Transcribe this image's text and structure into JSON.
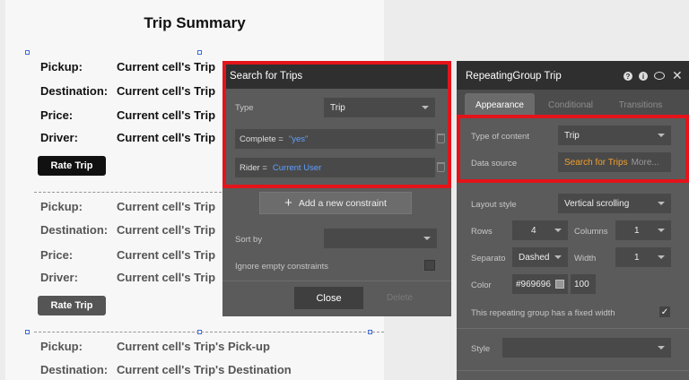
{
  "canvas": {
    "title": "Trip Summary",
    "cells": [
      {
        "pickup_label": "Pickup:",
        "pickup_value": "Current cell's Trip",
        "destination_label": "Destination:",
        "destination_value": "Current cell's Trip",
        "price_label": "Price:",
        "price_value": "Current cell's Trip",
        "driver_label": "Driver:",
        "driver_value": "Current cell's Trip",
        "button_label": "Rate Trip"
      },
      {
        "pickup_label": "Pickup:",
        "pickup_value": "Current cell's Trip",
        "destination_label": "Destination:",
        "destination_value": "Current cell's Trip",
        "price_label": "Price:",
        "price_value": "Current cell's Trip",
        "driver_label": "Driver:",
        "driver_value": "Current cell's Trip",
        "button_label": "Rate Trip"
      },
      {
        "pickup_label": "Pickup:",
        "pickup_value": "Current cell's Trip's Pick-up",
        "destination_label": "Destination:",
        "destination_value": "Current cell's Trip's Destination"
      }
    ]
  },
  "search_panel": {
    "title": "Search for Trips",
    "type_label": "Type",
    "type_value": "Trip",
    "constraints": [
      {
        "field": "Complete =",
        "value": "\"yes\""
      },
      {
        "field": "Rider =",
        "value": "Current User"
      }
    ],
    "add_constraint_label": "Add a new constraint",
    "add_icon": "+",
    "sort_by_label": "Sort by",
    "sort_by_value": "",
    "ignore_empty_label": "Ignore empty constraints",
    "ignore_empty_checked": false,
    "close_label": "Close",
    "delete_label": "Delete"
  },
  "editor": {
    "title": "RepeatingGroup Trip",
    "header_icons": [
      "help-icon",
      "info-icon",
      "comment-icon",
      "close-icon"
    ],
    "tabs": [
      {
        "label": "Appearance",
        "active": true
      },
      {
        "label": "Conditional",
        "active": false
      },
      {
        "label": "Transitions",
        "active": false
      }
    ],
    "type_of_content_label": "Type of content",
    "type_of_content_value": "Trip",
    "data_source_label": "Data source",
    "data_source_value": "Search for Trips",
    "data_source_more": "More...",
    "layout_style_label": "Layout style",
    "layout_style_value": "Vertical scrolling",
    "rows_label": "Rows",
    "rows_value": "4",
    "columns_label": "Columns",
    "columns_value": "1",
    "separator_label": "Separato",
    "separator_value": "Dashed",
    "width_label": "Width",
    "width_value": "1",
    "color_label": "Color",
    "color_hex": "#969696",
    "color_opacity": "100",
    "fixed_width_label": "This repeating group has a fixed width",
    "fixed_width_checked": true,
    "style_label": "Style",
    "style_value": ""
  },
  "colors": {
    "highlight_red": "#e3141a",
    "link_blue": "#5fa0ff",
    "data_source_orange": "#f0a030"
  }
}
